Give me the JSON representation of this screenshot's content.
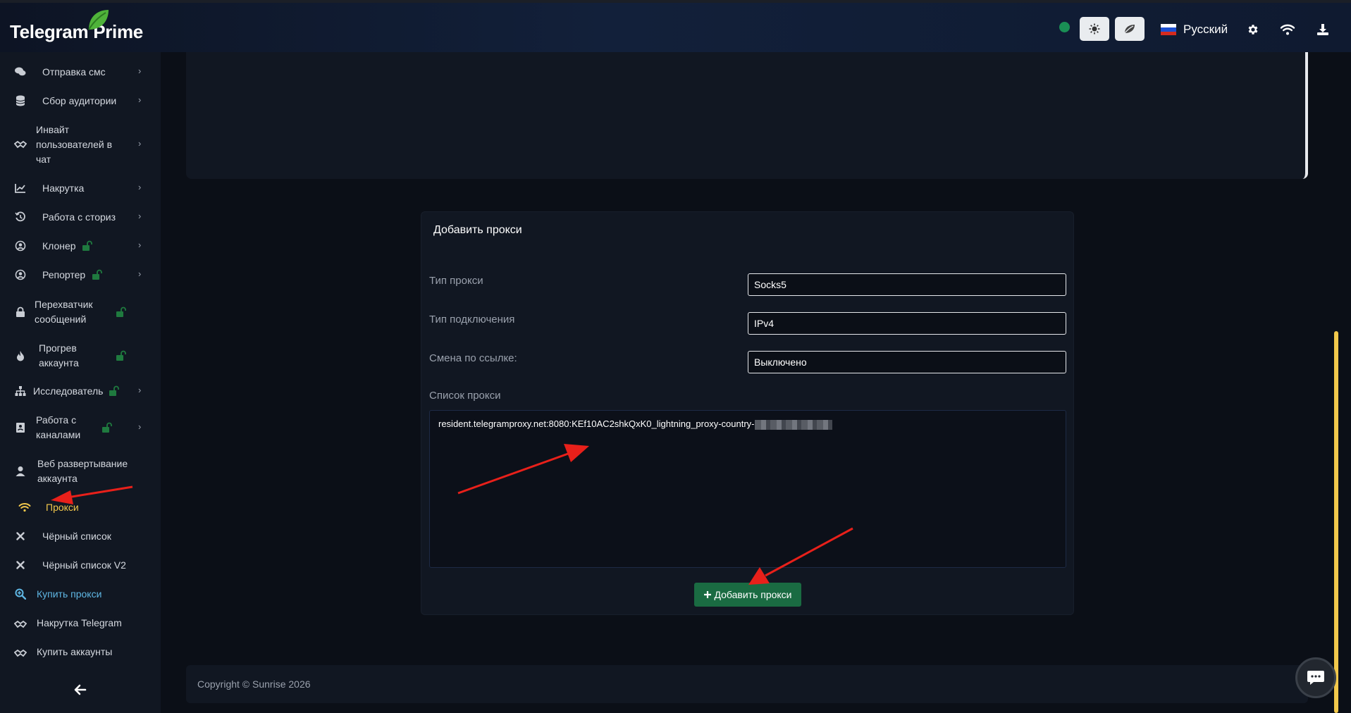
{
  "app": {
    "title": "Telegram Prime"
  },
  "header": {
    "language": "Русский",
    "theme_light_icon": "sun-icon",
    "theme_leaf_icon": "leaf-icon",
    "settings_icon": "gear-icon",
    "network_icon": "wifi-icon",
    "download_icon": "download-icon"
  },
  "sidebar": {
    "items": [
      {
        "label": "Отправка смс",
        "icon": "chat-icon"
      },
      {
        "label": "Сбор аудитории",
        "icon": "database-icon"
      },
      {
        "label": "Инвайт пользователей в чат",
        "icon": "handshake-icon"
      },
      {
        "label": "Накрутка",
        "icon": "chart-icon"
      },
      {
        "label": "Работа с сториз",
        "icon": "history-icon"
      },
      {
        "label": "Клонер",
        "icon": "user-circle-icon"
      },
      {
        "label": "Репортер",
        "icon": "user-circle-icon"
      },
      {
        "label": "Перехватчик сообщений",
        "icon": "lock-icon"
      },
      {
        "label": "Прогрев аккаунта",
        "icon": "fire-icon"
      },
      {
        "label": "Исследователь",
        "icon": "sitemap-icon"
      },
      {
        "label": "Работа с каналами",
        "icon": "address-book-icon"
      },
      {
        "label": "Веб развертывание аккаунта",
        "icon": "user-icon"
      },
      {
        "label": "Прокси",
        "icon": "wifi-icon"
      },
      {
        "label": "Чёрный список",
        "icon": "close-icon"
      },
      {
        "label": "Чёрный список V2",
        "icon": "close-icon"
      },
      {
        "label": "Купить прокси",
        "icon": "search-plus-icon"
      },
      {
        "label": "Накрутка Telegram",
        "icon": "handshake-icon"
      },
      {
        "label": "Купить аккаунты",
        "icon": "handshake-icon"
      }
    ]
  },
  "form": {
    "title": "Добавить прокси",
    "proxy_type_label": "Тип прокси",
    "proxy_type_value": "Socks5",
    "connection_type_label": "Тип подключения",
    "connection_type_value": "IPv4",
    "link_change_label": "Смена по ссылке:",
    "link_change_value": "Выключено",
    "proxy_list_label": "Список прокси",
    "proxy_list_value": "resident.telegramproxy.net:8080:KEf10AC2shkQxK0_lightning_proxy-country-",
    "submit_label": "Добавить прокси"
  },
  "footer": {
    "copyright": "Copyright © Sunrise 2026"
  },
  "colors": {
    "accent_green": "#1a6b42",
    "active_yellow": "#f2c84b",
    "link_cyan": "#5fb7e4",
    "annotation_red": "#e8201a"
  }
}
